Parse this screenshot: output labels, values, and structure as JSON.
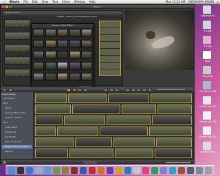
{
  "menubar": {
    "app_name": "iMovie",
    "menus": [
      "File",
      "Edit",
      "View",
      "Text",
      "Share",
      "Window",
      "Help"
    ],
    "clock": "Mon 12:12 AM",
    "user": "CHESHAMA NAOMI"
  },
  "window": {
    "title": "iMovie",
    "project_title": "Project — Bunny & Snap Nature Scene"
  },
  "project_library": {
    "header": "Project Library"
  },
  "video_effects": {
    "title": "Choose Video Effect",
    "done_label": "Done"
  },
  "event_library": {
    "header": "Event Library",
    "items": [
      {
        "label": "Last Import"
      },
      {
        "label": "2011"
      },
      {
        "label": "Sept 3"
      },
      {
        "label": "Imported Production"
      },
      {
        "label": "Sept 3 / Untitled"
      },
      {
        "label": "2010"
      },
      {
        "label": "Video Event"
      },
      {
        "label": "New Event"
      },
      {
        "label": "Bla Bla Bla"
      },
      {
        "label": "Dark and Gothic"
      },
      {
        "label": "Project: Bunny & Snap",
        "selected": true
      },
      {
        "label": "Sept 24"
      }
    ]
  },
  "desktop_icons": [
    {
      "label": "Cashmere FA"
    },
    {
      "label": "5.1.jpg"
    },
    {
      "label": "5.2.jpg"
    },
    {
      "label": "BLAH"
    },
    {
      "label": "Sony Edit"
    },
    {
      "label": "OverMe At Night"
    },
    {
      "label": "Screen shot 2011-10 Old"
    },
    {
      "label": "Screen shot 2011-11-10 3.png"
    },
    {
      "label": "Screen shot 2011-11-10 3.png"
    },
    {
      "label": "Untitled.mp4"
    }
  ],
  "colors": {
    "accent_selected": "#6f86b5",
    "clip_border": "#b9a046"
  }
}
